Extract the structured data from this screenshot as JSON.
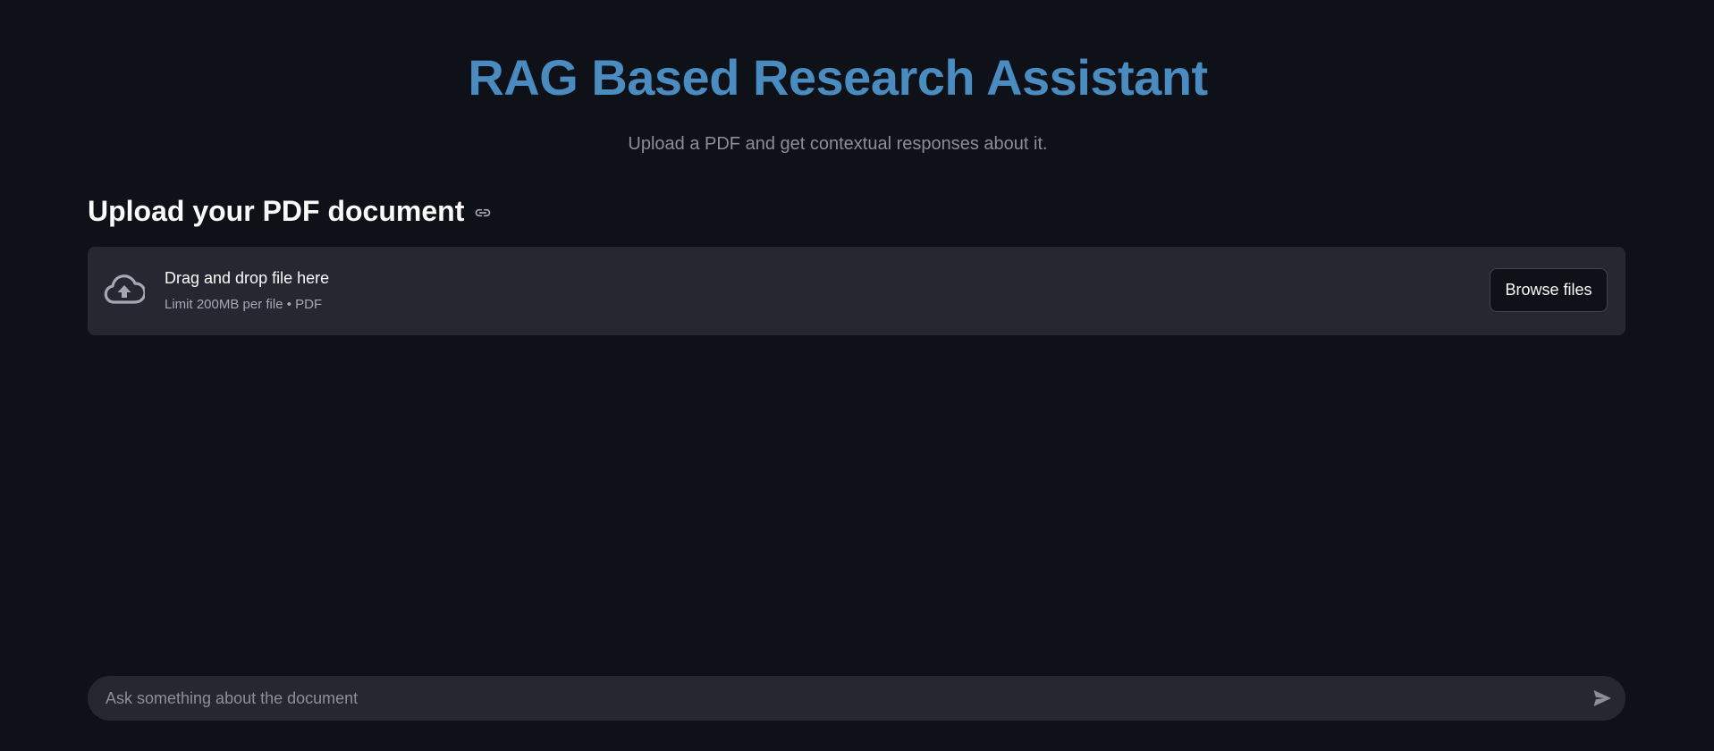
{
  "header": {
    "title": "RAG Based Research Assistant",
    "subtitle": "Upload a PDF and get contextual responses about it."
  },
  "upload": {
    "section_title": "Upload your PDF document",
    "link_icon": "link-icon",
    "dropzone_title": "Drag and drop file here",
    "dropzone_limit": "Limit 200MB per file • PDF",
    "upload_icon": "cloud-upload-icon",
    "browse_label": "Browse files"
  },
  "chat": {
    "placeholder": "Ask something about the document",
    "value": "",
    "send_icon": "send-icon"
  },
  "colors": {
    "background": "#0e1117",
    "title": "#4a8bc0",
    "surface": "#262730",
    "text": "#fafafa",
    "muted": "#8b8f96"
  }
}
